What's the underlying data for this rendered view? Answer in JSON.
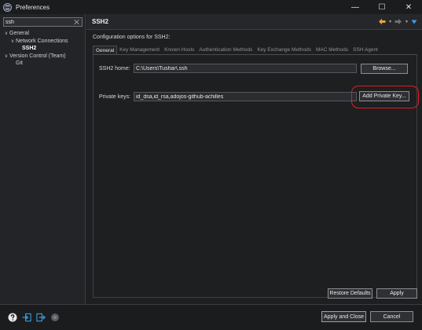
{
  "window": {
    "title": "Preferences",
    "controls": {
      "minimize": "—",
      "maximize": "☐",
      "close": "✕"
    }
  },
  "sidebar": {
    "filter_value": "ssh",
    "tree": [
      {
        "label": "General",
        "expanded": true,
        "level": 0
      },
      {
        "label": "Network Connections",
        "expanded": true,
        "level": 1
      },
      {
        "label": "SSH2",
        "level": 2,
        "selected": true
      },
      {
        "label": "Version Control (Team)",
        "expanded": true,
        "level": 0
      },
      {
        "label": "Git",
        "level": 1
      }
    ]
  },
  "page": {
    "title": "SSH2",
    "description": "Configuration options for SSH2:",
    "tabs": [
      {
        "label": "General",
        "active": true
      },
      {
        "label": "Key Management"
      },
      {
        "label": "Known Hosts"
      },
      {
        "label": "Authentication Methods"
      },
      {
        "label": "Key Exchange Methods"
      },
      {
        "label": "MAC Methods"
      },
      {
        "label": "SSH Agent"
      }
    ],
    "ssh2_home_label": "SSH2 home:",
    "ssh2_home_value": "C:\\Users\\Tushar\\.ssh",
    "browse_label": "Browse...",
    "private_keys_label": "Private keys:",
    "private_keys_value": "id_dsa,id_rsa,adojos-github-achilles",
    "add_private_key_label": "Add Private Key...",
    "restore_defaults_label": "Restore Defaults",
    "apply_label": "Apply"
  },
  "footer": {
    "apply_close_label": "Apply and Close",
    "cancel_label": "Cancel",
    "icons": [
      "help-icon",
      "import-icon",
      "export-icon",
      "oomph-icon"
    ]
  },
  "colors": {
    "accent_nav": "#e8a33d",
    "highlight_ring": "#e0201f",
    "link_icon": "#3a9be0"
  }
}
